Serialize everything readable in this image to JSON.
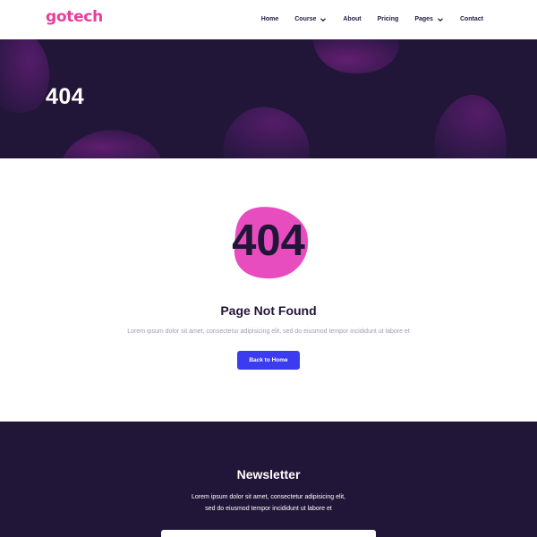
{
  "header": {
    "logo": "gotech",
    "nav": [
      {
        "label": "Home"
      },
      {
        "label": "Course",
        "has_dropdown": true
      },
      {
        "label": "About"
      },
      {
        "label": "Pricing"
      },
      {
        "label": "Pages",
        "has_dropdown": true
      },
      {
        "label": "Contact"
      }
    ]
  },
  "hero": {
    "title": "404"
  },
  "main": {
    "art_text": "404",
    "title": "Page Not Found",
    "description": "Lorem ipsum dolor sit amet, consectetur adipisicing elit, sed do eiusmod tempor incididunt ut labore et",
    "button_label": "Back to Home"
  },
  "newsletter": {
    "title": "Newsletter",
    "line1": "Lorem ipsum dolor sit amet, consectetur adipisicing elit,",
    "line2": "sed do eiusmod tempor incididunt ut labore et",
    "input_placeholder": ""
  },
  "colors": {
    "brand_pink": "#e83e9b",
    "dark_navy": "#211638",
    "button_blue": "#3b3bf0",
    "muted_text": "#a09cb4"
  },
  "icons": {
    "dropdown": "chevron-down-icon"
  }
}
